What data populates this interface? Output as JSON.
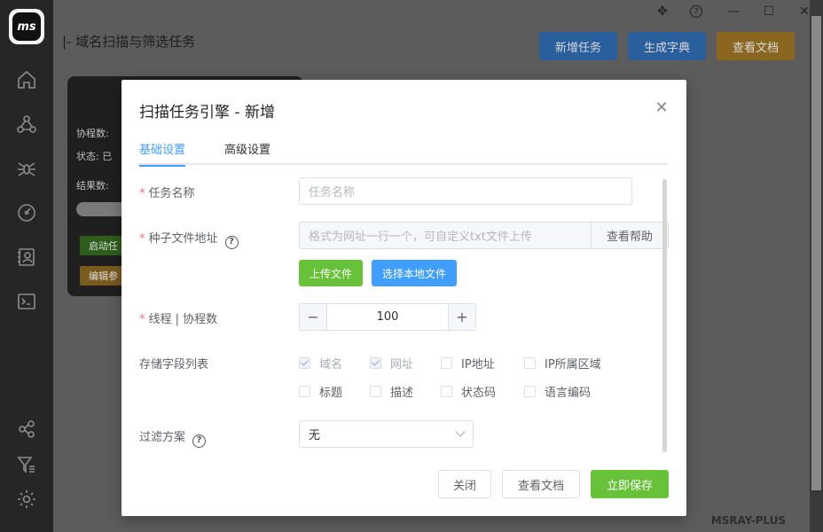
{
  "app": {
    "logo_text": "ms",
    "page_title": "|- 域名扫描与筛选任务",
    "watermark": "MSRAY-PLUS"
  },
  "sidebar": {
    "icons": [
      "home-icon",
      "share-network-icon",
      "spider-icon",
      "gauge-icon",
      "contact-card-icon",
      "terminal-icon",
      "nodes-icon",
      "filter-list-icon",
      "settings-gear-icon"
    ]
  },
  "header_buttons": {
    "new_task": "新增任务",
    "gen_dict": "生成字典",
    "view_docs": "查看文档"
  },
  "background_card": {
    "coroutines": "协程数:",
    "status": "状态: 已",
    "results": "结果数:",
    "start_btn": "启动任",
    "edit_btn": "编辑参"
  },
  "modal": {
    "title": "扫描任务引擎 - 新增",
    "tabs": [
      {
        "label": "基础设置",
        "active": true
      },
      {
        "label": "高级设置",
        "active": false
      }
    ],
    "task_name": {
      "label": "任务名称",
      "placeholder": "任务名称",
      "value": ""
    },
    "seed_file": {
      "label": "种子文件地址",
      "placeholder": "格式为网址一行一个，可自定义txt文件上传",
      "help_btn": "查看帮助"
    },
    "upload_btn": "上传文件",
    "choose_local_btn": "选择本地文件",
    "threads": {
      "label": "线程 | 协程数",
      "value": "100",
      "minus": "−",
      "plus": "+"
    },
    "fields": {
      "label": "存储字段列表",
      "options": [
        {
          "label": "域名",
          "checked": true
        },
        {
          "label": "网址",
          "checked": true
        },
        {
          "label": "IP地址",
          "checked": false
        },
        {
          "label": "IP所属区域",
          "checked": false
        },
        {
          "label": "标题",
          "checked": false
        },
        {
          "label": "描述",
          "checked": false
        },
        {
          "label": "状态码",
          "checked": false
        },
        {
          "label": "语言编码",
          "checked": false
        }
      ]
    },
    "filter": {
      "label": "过滤方案",
      "value": "无"
    },
    "footer": {
      "close": "关闭",
      "view_docs": "查看文档",
      "save_now": "立即保存"
    }
  },
  "colors": {
    "primary": "#409eff",
    "success": "#67c23a",
    "warning": "#e6a23c",
    "required": "#f56c6c"
  }
}
